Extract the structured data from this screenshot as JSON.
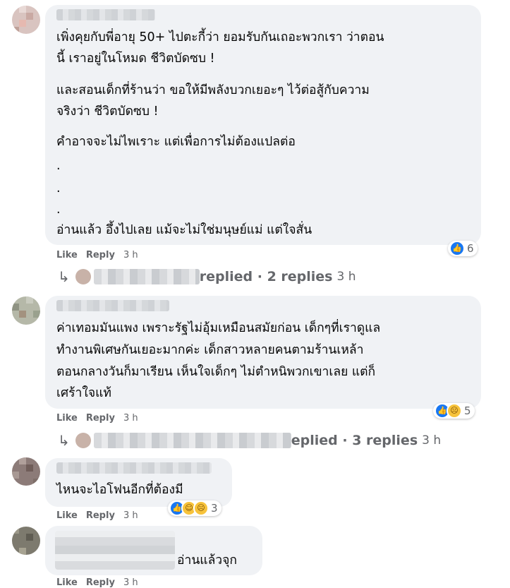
{
  "comments": [
    {
      "lines": [
        "เพิ่งคุยกับพี่อายุ 50+ ไปตะกี้ว่า ยอมรับกันเถอะพวกเรา ว่าตอน",
        "นี้ เราอยู่ในโหมด ชีวิตบัดซบ !",
        "",
        "และสอนเด็กที่ร้านว่า ขอให้มีพลังบวกเยอะๆ ไว้ต่อสู้กับความ",
        "จริงว่า ชีวิตบัดซบ !",
        "",
        "คำอาจจะไม่ไพเราะ แต่เพื่อการไม่ต้องแปลต่อ",
        ".",
        ".",
        ".",
        "อ่านแล้ว อึ้งไปเลย แม้จะไม่ใช่มนุษย์แม่ แต่ใจสั่น"
      ],
      "like": "Like",
      "reply": "Reply",
      "time": "3 h",
      "reaction_count": "6",
      "replies_text": "replied · 2 replies",
      "replies_time": "3 h"
    },
    {
      "lines": [
        "ค่าเทอมมันแพง เพราะรัฐไม่อุ้มเหมือนสมัยก่อน เด็กๆที่เราดูแล",
        "ทำงานพิเศษกันเยอะมากค่ะ เด็กสาวหลายคนตามร้านเหล้า",
        "ตอนกลางวันก็มาเรียน เห็นใจเด็กๆ ไม่ตำหนิพวกเขาเลย แต่ก็",
        "เศร้าใจแท้"
      ],
      "like": "Like",
      "reply": "Reply",
      "time": "3 h",
      "reaction_count": "5",
      "replies_text": "eplied · 3 replies",
      "replies_time": "3 h"
    },
    {
      "lines": [
        "ไหนจะไอโฟนอีกที่ต้องมี"
      ],
      "like": "Like",
      "reply": "Reply",
      "time": "3 h",
      "reaction_count": "3"
    },
    {
      "lines": [
        "อ่านแล้วจุก"
      ],
      "like": "Like",
      "reply": "Reply",
      "time": "3 h"
    }
  ],
  "icons": {
    "like": "thumbs-up-icon",
    "sad": "sad-face-icon",
    "haha": "haha-face-icon",
    "reply_arrow": "reply-arrow-icon"
  },
  "colors": {
    "bubble": "#f0f2f5",
    "meta": "#65676b",
    "like_blue": "#1877f2"
  }
}
